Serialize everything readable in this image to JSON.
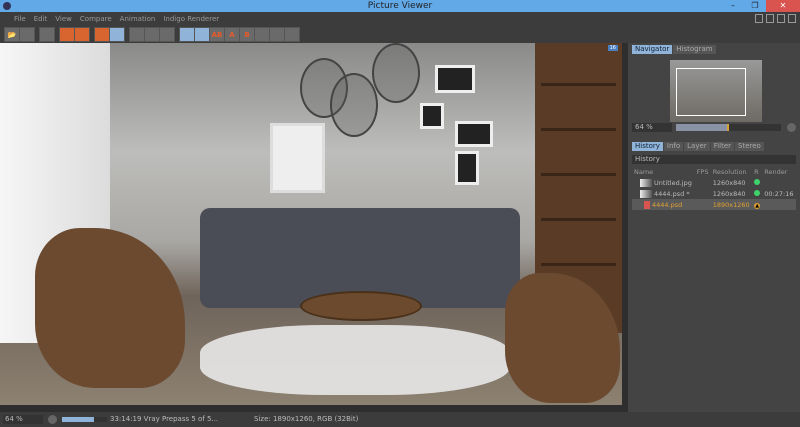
{
  "window": {
    "title": "Picture Viewer",
    "minimize": "–",
    "maximize": "❐",
    "close": "✕"
  },
  "menu": [
    "File",
    "Edit",
    "View",
    "Compare",
    "Animation",
    "Indigo Renderer"
  ],
  "toolbar": {
    "ab_label": "AB",
    "a_label": "A",
    "b_label": "B"
  },
  "viewport": {
    "badge": "16"
  },
  "navigator": {
    "tabs": [
      "Navigator",
      "Histogram"
    ],
    "zoom": "64 %",
    "zoom_slider_fraction": 0.5
  },
  "history": {
    "tabs": [
      "History",
      "Info",
      "Layer",
      "Filter",
      "Stereo"
    ],
    "header": "History",
    "columns": [
      "Name",
      "FPS",
      "Resolution",
      "R",
      "Render"
    ],
    "rows": [
      {
        "name": "Untitled.jpg",
        "fps": "",
        "resolution": "1260x840",
        "status": "green",
        "render": ""
      },
      {
        "name": "4444.psd *",
        "fps": "",
        "resolution": "1260x840",
        "status": "green",
        "render": "00:27:16"
      },
      {
        "name": "4444.psd",
        "fps": "",
        "resolution": "1890x1260",
        "status": "warning",
        "render": ""
      }
    ]
  },
  "status": {
    "zoom": "64 %",
    "progress_fraction": 0.7,
    "render_text": "33:14:19 Vray Prepass 5 of 5...",
    "size_text": "Size: 1890x1260, RGB (32Bit)"
  },
  "colors": {
    "accent": "#8fb3d9",
    "titlebar": "#62a9e8",
    "selected_text": "#e0a030"
  }
}
